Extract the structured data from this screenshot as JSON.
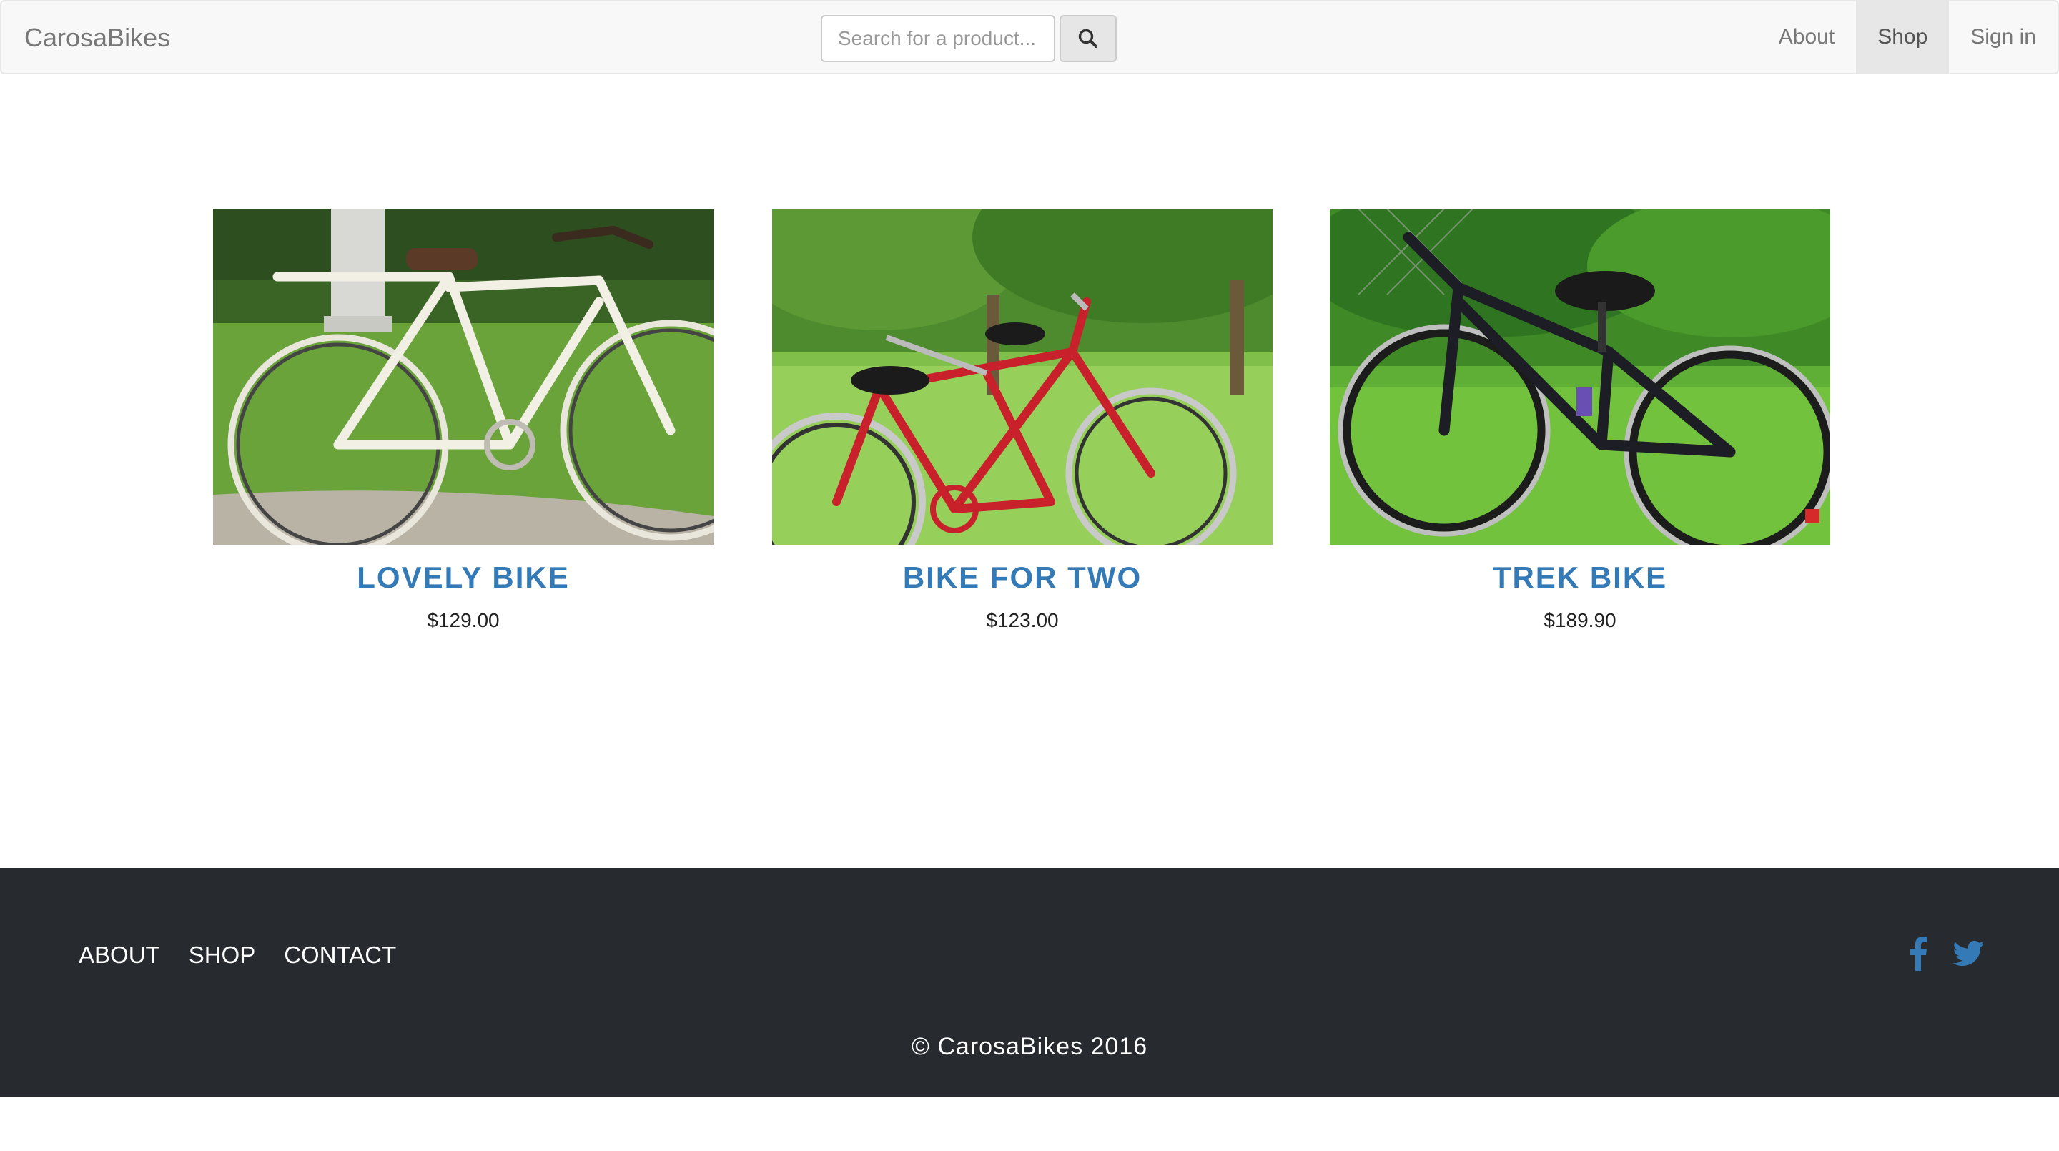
{
  "navbar": {
    "brand": "CarosaBikes",
    "search": {
      "placeholder": "Search for a product...",
      "value": ""
    },
    "search_button_icon": "search-icon",
    "links": [
      {
        "label": "About",
        "active": false
      },
      {
        "label": "Shop",
        "active": true
      },
      {
        "label": "Sign in",
        "active": false
      }
    ]
  },
  "products": [
    {
      "name": "LOVELY BIKE",
      "price": "$129.00",
      "image": "white-vintage-bicycle-photo"
    },
    {
      "name": "BIKE FOR TWO",
      "price": "$123.00",
      "image": "red-tandem-bicycle-photo"
    },
    {
      "name": "TREK BIKE",
      "price": "$189.90",
      "image": "black-trek-mountain-bike-photo"
    }
  ],
  "footer": {
    "links": [
      "ABOUT",
      "SHOP",
      "CONTACT"
    ],
    "social_icons": [
      "facebook-icon",
      "twitter-icon"
    ],
    "copyright": "© CarosaBikes 2016"
  },
  "colors": {
    "accent": "#337ab7",
    "navbar_bg": "#f8f8f8",
    "footer_bg": "#272b30",
    "active_nav_bg": "#e7e7e7"
  }
}
